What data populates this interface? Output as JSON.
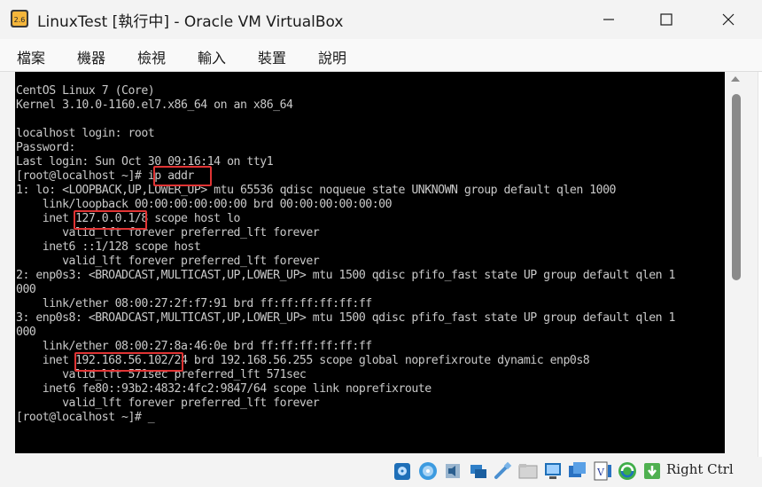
{
  "window": {
    "title": "LinuxTest [執行中] - Oracle VM VirtualBox",
    "icon_label": "2.6",
    "controls": [
      "minimize-icon",
      "maximize-icon",
      "close-icon"
    ]
  },
  "menu": {
    "items": [
      {
        "label": "檔案"
      },
      {
        "label": "機器"
      },
      {
        "label": "檢視"
      },
      {
        "label": "輸入"
      },
      {
        "label": "裝置"
      },
      {
        "label": "說明"
      }
    ]
  },
  "console": {
    "lines": [
      "CentOS Linux 7 (Core)",
      "Kernel 3.10.0-1160.el7.x86_64 on an x86_64",
      "",
      "localhost login: root",
      "Password:",
      "Last login: Sun Oct 30 09:16:14 on tty1",
      "[root@localhost ~]# ip addr",
      "1: lo: <LOOPBACK,UP,LOWER_UP> mtu 65536 qdisc noqueue state UNKNOWN group default qlen 1000",
      "    link/loopback 00:00:00:00:00:00 brd 00:00:00:00:00:00",
      "    inet 127.0.0.1/8 scope host lo",
      "       valid_lft forever preferred_lft forever",
      "    inet6 ::1/128 scope host",
      "       valid_lft forever preferred_lft forever",
      "2: enp0s3: <BROADCAST,MULTICAST,UP,LOWER_UP> mtu 1500 qdisc pfifo_fast state UP group default qlen 1",
      "000",
      "    link/ether 08:00:27:2f:f7:91 brd ff:ff:ff:ff:ff:ff",
      "3: enp0s8: <BROADCAST,MULTICAST,UP,LOWER_UP> mtu 1500 qdisc pfifo_fast state UP group default qlen 1",
      "000",
      "    link/ether 08:00:27:8a:46:0e brd ff:ff:ff:ff:ff:ff",
      "    inet 192.168.56.102/24 brd 192.168.56.255 scope global noprefixroute dynamic enp0s8",
      "       valid_lft 571sec preferred_lft 571sec",
      "    inet6 fe80::93b2:4832:4fc2:9847/64 scope link noprefixroute",
      "       valid_lft forever preferred_lft forever",
      "[root@localhost ~]# _"
    ],
    "highlights": [
      {
        "text": "ip addr"
      },
      {
        "text": "127.0.0.1"
      },
      {
        "text": "192.168.56.102"
      }
    ],
    "highlight_color": "#e03434"
  },
  "statusbar": {
    "icons": [
      "hard-disk-icon",
      "optical-disk-icon",
      "audio-icon",
      "network-icon",
      "usb-icon",
      "shared-folders-icon",
      "display-icon",
      "recording-icon",
      "cpu-icon",
      "mouse-integration-icon",
      "keyboard-icon"
    ],
    "host_key": "Right Ctrl"
  }
}
